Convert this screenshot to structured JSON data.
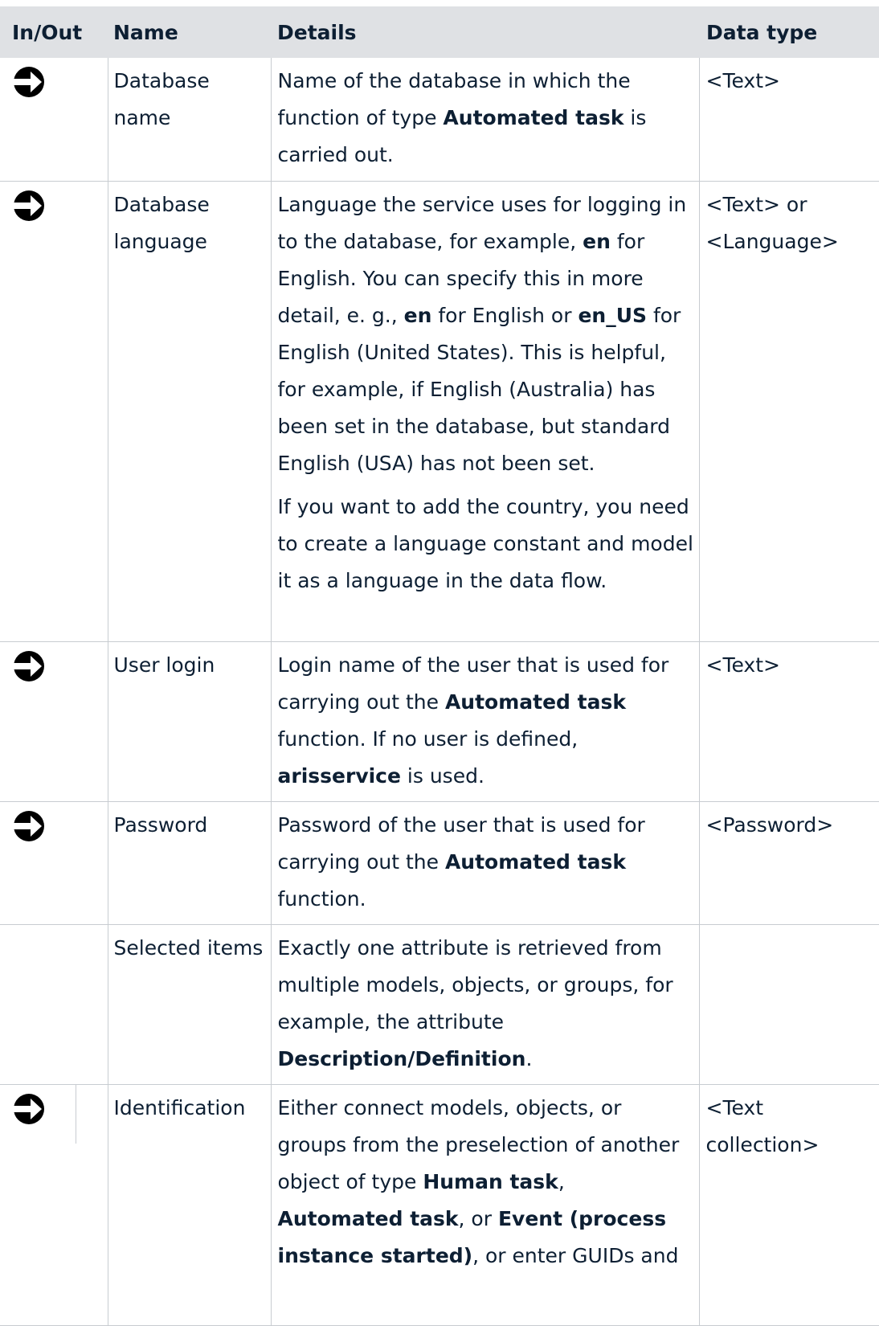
{
  "header": {
    "inout": "In/Out",
    "name": "Name",
    "details": "Details",
    "datatype": "Data type"
  },
  "rows": [
    {
      "icon": "input-arrow-icon",
      "name": "Database name",
      "details": [
        [
          "Name of the database in which the function of type ",
          {
            "b": "Automated task"
          },
          " is carried out."
        ]
      ],
      "type": "<Text>"
    },
    {
      "icon": "input-arrow-icon",
      "name": "Database language",
      "details": [
        [
          "Language the service uses for logging in to the database, for example, ",
          {
            "b": "en"
          },
          " for English. You can specify this in more detail, e. g., ",
          {
            "b": "en"
          },
          " for English or ",
          {
            "b": "en_US"
          },
          " for English (United States). This is helpful, for example, if English (Australia) has been set in the database, but standard English (USA) has not been set."
        ],
        [
          "If you want to add the country, you need to create a language constant and model it as a language in the data flow."
        ]
      ],
      "type": "<Text> or <Language>"
    },
    {
      "icon": "input-arrow-icon",
      "name": "User login",
      "details": [
        [
          "Login name of the user that is used for carrying out the ",
          {
            "b": "Automated task"
          },
          " function. If no user is defined, ",
          {
            "b": "arisservice"
          },
          " is used."
        ]
      ],
      "type": "<Text>"
    },
    {
      "icon": "input-arrow-icon",
      "name": "Password",
      "details": [
        [
          "Password of the user that is used for carrying out the ",
          {
            "b": "Automated task"
          },
          " function."
        ]
      ],
      "type": "<Password>"
    },
    {
      "icon": "",
      "name": "Selected items",
      "details": [
        [
          "Exactly one attribute is retrieved from multiple models, objects, or groups, for example, the attribute ",
          {
            "b": "Description/Definition"
          },
          "."
        ]
      ],
      "type": ""
    },
    {
      "icon": "input-arrow-icon",
      "split": true,
      "name": "Identification",
      "details": [
        [
          "Either connect models, objects, or groups from the preselection of another object of type ",
          {
            "b": "Human task"
          },
          ", ",
          {
            "b": "Automated task"
          },
          ", or ",
          {
            "b": "Event (process instance started)"
          },
          ", or enter GUIDs and"
        ]
      ],
      "type": "<Text collection>"
    }
  ]
}
